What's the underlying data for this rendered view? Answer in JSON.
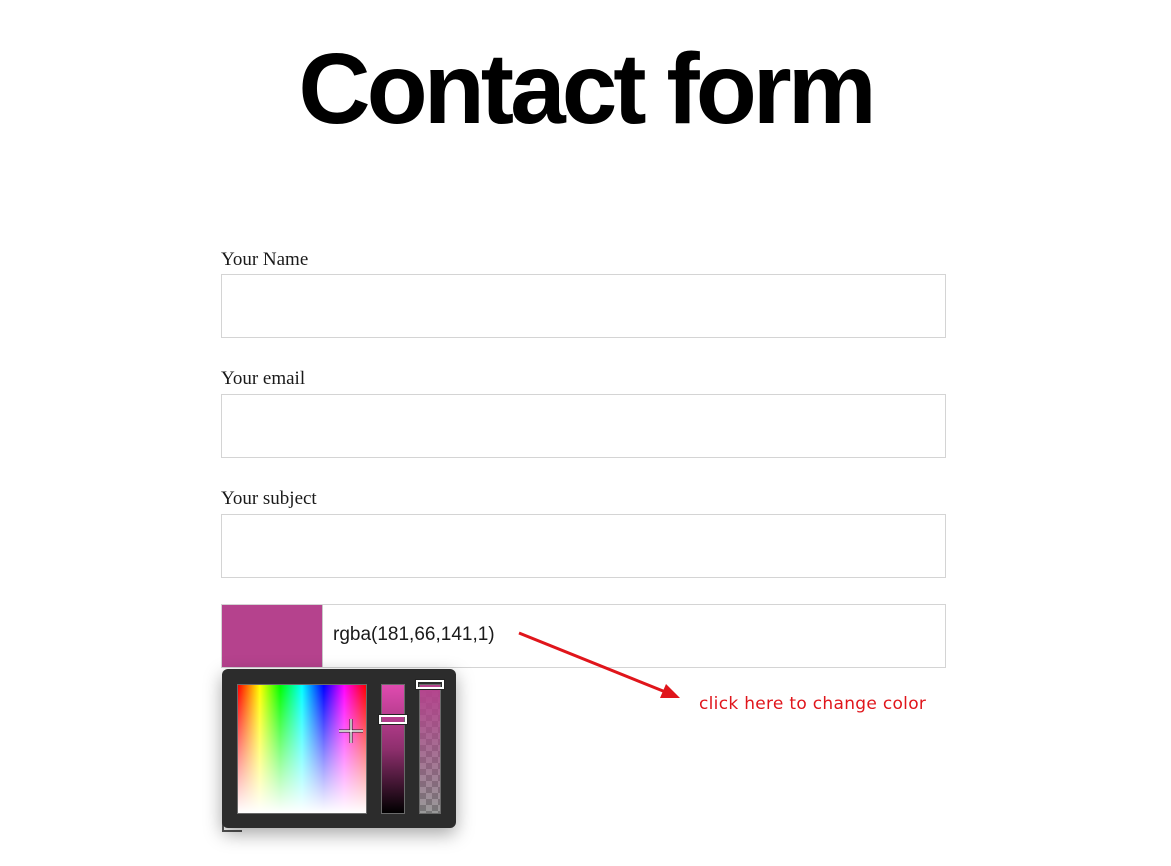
{
  "page": {
    "title": "Contact form"
  },
  "form": {
    "name_label": "Your Name",
    "name_value": "",
    "email_label": "Your email",
    "email_value": "",
    "subject_label": "Your subject",
    "subject_value": "",
    "color_value": "rgba(181,66,141,1)"
  },
  "picker": {
    "selected_color": "#b5428d",
    "alpha": 1
  },
  "annotation": {
    "text": "click here to change color",
    "color": "#e0151b"
  }
}
